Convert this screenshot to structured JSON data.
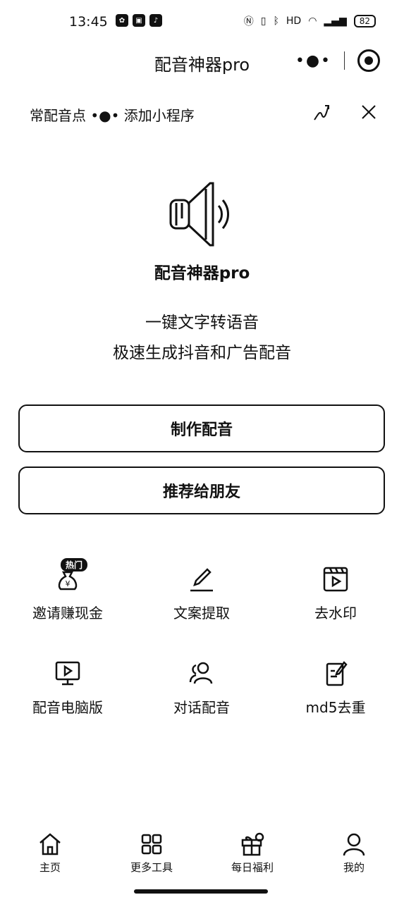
{
  "status_bar": {
    "time": "13:45",
    "left_icons": [
      "pinwheel-icon",
      "app-badge-icon",
      "tiktok-icon"
    ],
    "right_icons": [
      "nfc-icon",
      "vibrate-icon",
      "bluetooth-icon",
      "hd-icon",
      "wifi-icon",
      "signal-5g-icon"
    ],
    "battery": "82"
  },
  "navbar": {
    "title": "配音神器pro",
    "more_label": "•●•"
  },
  "add_tip": {
    "text": "常配音点 •●• 添加小程序"
  },
  "hero": {
    "app_name": "配音神器pro",
    "slogan_line1": "一键文字转语音",
    "slogan_line2": "极速生成抖音和广告配音"
  },
  "buttons": {
    "make_dubbing": "制作配音",
    "recommend": "推荐给朋友"
  },
  "features": [
    {
      "label": "邀请赚现金",
      "icon": "money-bag-icon",
      "badge": "热门"
    },
    {
      "label": "文案提取",
      "icon": "pen-icon"
    },
    {
      "label": "去水印",
      "icon": "video-icon"
    },
    {
      "label": "配音电脑版",
      "icon": "monitor-icon"
    },
    {
      "label": "对话配音",
      "icon": "users-icon"
    },
    {
      "label": "md5去重",
      "icon": "document-edit-icon"
    }
  ],
  "tabbar": {
    "items": [
      {
        "label": "主页",
        "icon": "home-icon"
      },
      {
        "label": "更多工具",
        "icon": "grid-icon"
      },
      {
        "label": "每日福利",
        "icon": "gift-icon"
      },
      {
        "label": "我的",
        "icon": "user-icon"
      }
    ]
  },
  "colors": {
    "primary": "#111111",
    "background": "#ffffff"
  }
}
